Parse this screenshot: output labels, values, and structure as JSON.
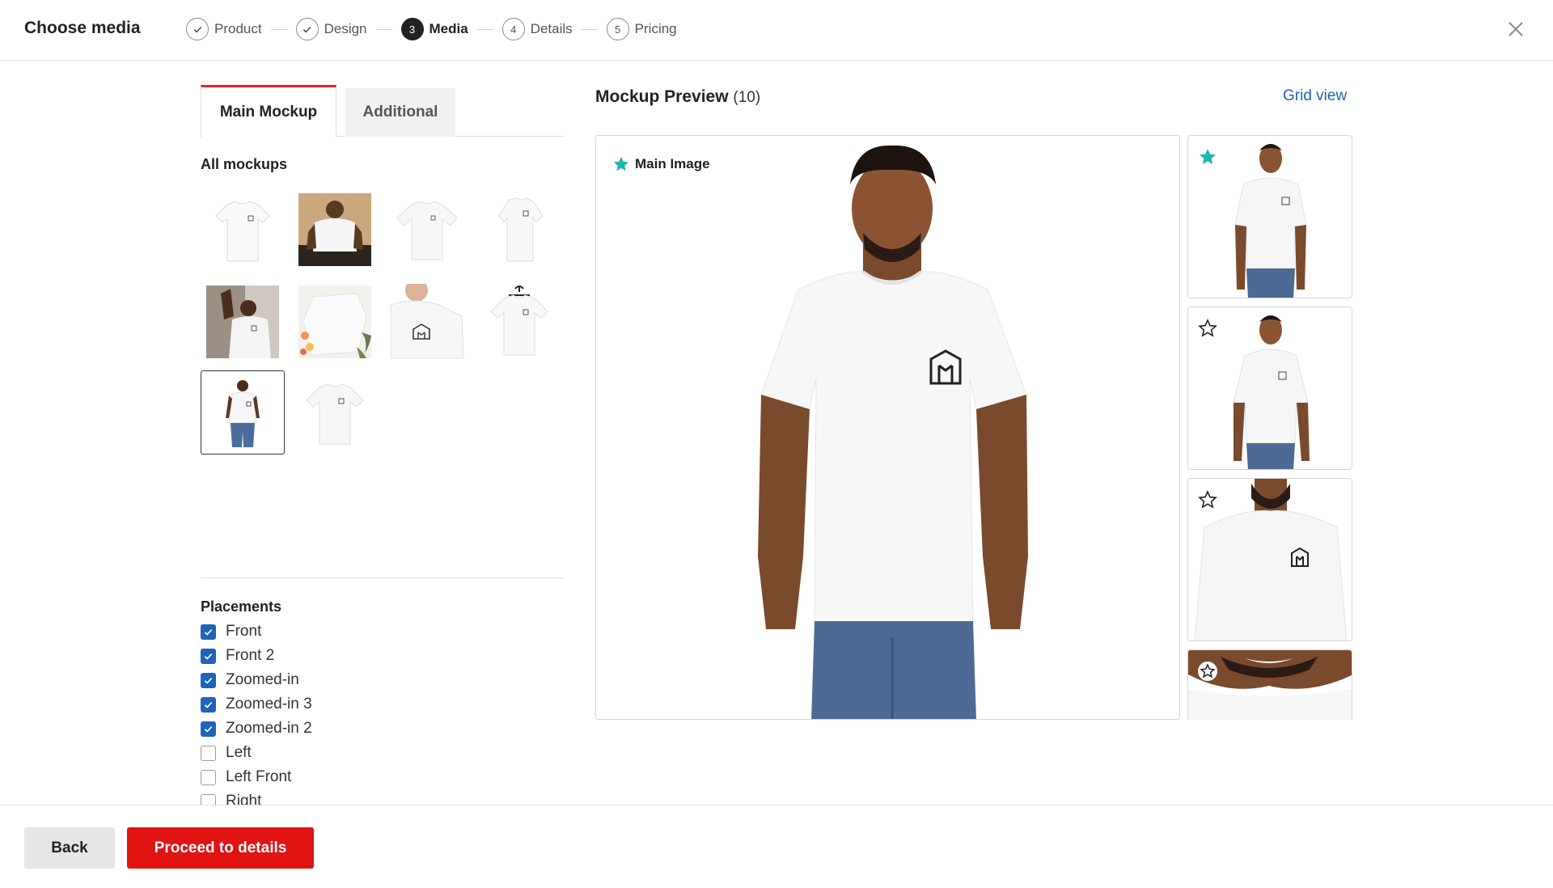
{
  "header": {
    "title": "Choose media",
    "steps": [
      {
        "number": "1",
        "label": "Product",
        "state": "done"
      },
      {
        "number": "2",
        "label": "Design",
        "state": "done"
      },
      {
        "number": "3",
        "label": "Media",
        "state": "active"
      },
      {
        "number": "4",
        "label": "Details",
        "state": "pending"
      },
      {
        "number": "5",
        "label": "Pricing",
        "state": "pending"
      }
    ],
    "close_icon": "close-icon"
  },
  "tabs": {
    "main": "Main Mockup",
    "additional": "Additional",
    "active": "Main Mockup"
  },
  "mockups": {
    "heading": "All mockups",
    "items": [
      {
        "kind": "flat-tee",
        "selected": false
      },
      {
        "kind": "model-sitting",
        "selected": false
      },
      {
        "kind": "flat-tee",
        "selected": false
      },
      {
        "kind": "tee-side",
        "selected": false
      },
      {
        "kind": "model-window",
        "selected": false
      },
      {
        "kind": "flat-lay-flowers",
        "selected": false
      },
      {
        "kind": "chest-zoom",
        "selected": false
      },
      {
        "kind": "tee-hanger",
        "selected": false
      },
      {
        "kind": "model-front",
        "selected": true
      },
      {
        "kind": "flat-tee",
        "selected": false
      }
    ]
  },
  "placements": {
    "heading": "Placements",
    "items": [
      {
        "label": "Front",
        "checked": true
      },
      {
        "label": "Front 2",
        "checked": true
      },
      {
        "label": "Zoomed-in",
        "checked": true
      },
      {
        "label": "Zoomed-in 3",
        "checked": true
      },
      {
        "label": "Zoomed-in 2",
        "checked": true
      },
      {
        "label": "Left",
        "checked": false
      },
      {
        "label": "Left Front",
        "checked": false
      },
      {
        "label": "Right",
        "checked": false
      }
    ]
  },
  "preview": {
    "title": "Mockup Preview",
    "count": "(10)",
    "grid_view": "Grid view",
    "main_badge": "Main Image",
    "side_items": [
      {
        "starred": true
      },
      {
        "starred": false
      },
      {
        "starred": false
      },
      {
        "starred": false
      }
    ]
  },
  "footer": {
    "back": "Back",
    "proceed": "Proceed to details"
  },
  "colors": {
    "accent_red": "#e11313",
    "link_blue": "#1f64b8",
    "star_teal": "#1fb5b0"
  }
}
